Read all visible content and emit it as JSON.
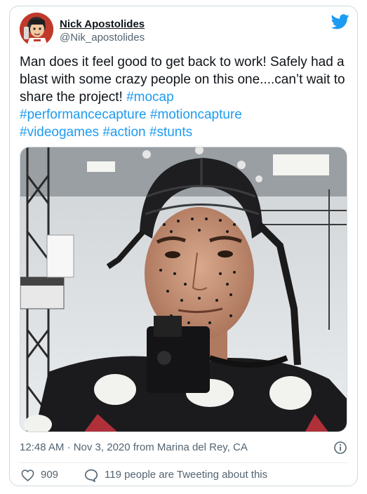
{
  "author": {
    "display_name": "Nick Apostolides",
    "handle": "@Nik_apostolides",
    "avatar_icon": "cartoon-avatar"
  },
  "brand": {
    "icon": "twitter-bird-icon",
    "color": "#1d9bf0"
  },
  "tweet": {
    "text_plain": "Man does it feel good to get back to work! Safely had a blast with some crazy people on this one....can’t wait to share the project! ",
    "hashtags": [
      "#mocap",
      "#performancecapture",
      "#motioncapture",
      "#videogames",
      "#action",
      "#stunts"
    ]
  },
  "media": {
    "icon": "photo-mocap-helmet"
  },
  "meta": {
    "timestamp": "12:48 AM · Nov 3, 2020 from Marina del Rey, CA",
    "info_icon": "info-icon"
  },
  "actions": {
    "like_count": "909",
    "like_icon": "heart-icon",
    "reply_text": "119 people are Tweeting about this",
    "reply_icon": "speech-bubble-icon"
  }
}
